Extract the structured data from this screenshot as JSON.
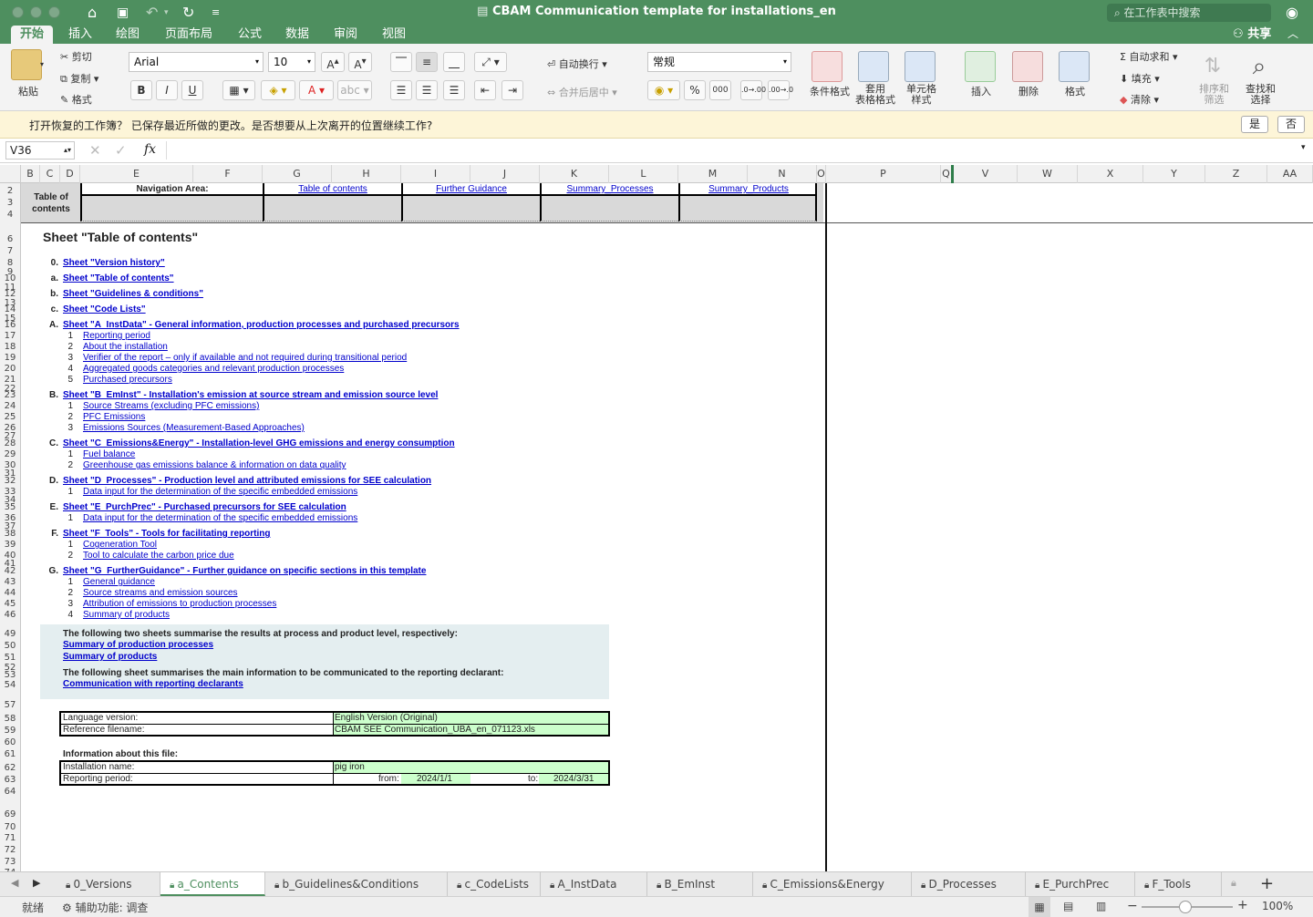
{
  "window": {
    "title": "CBAM Communication template for installations_en",
    "search_placeholder": "在工作表中搜索"
  },
  "ribbon_tabs": [
    "开始",
    "插入",
    "绘图",
    "页面布局",
    "公式",
    "数据",
    "审阅",
    "视图"
  ],
  "share_label": "共享",
  "ribbon": {
    "paste": "粘贴",
    "cut": "剪切",
    "copy": "复制",
    "format_painter": "格式",
    "font_name": "Arial",
    "font_size": "10",
    "bold": "B",
    "italic": "I",
    "underline": "U",
    "wrap_text": "自动换行",
    "merge_center": "合并后居中",
    "number_format": "常规",
    "percent": "%",
    "thousands": "000",
    "conditional_format": "条件格式",
    "table_format": "套用\n表格格式",
    "cell_style": "单元格\n样式",
    "insert": "插入",
    "delete": "删除",
    "format": "格式",
    "autosum": "自动求和",
    "fill": "填充",
    "clear": "清除",
    "sort_filter": "排序和\n筛选",
    "find_select": "查找和\n选择"
  },
  "recovery_bar": {
    "text": "打开恢复的工作簿？ 已保存最近所做的更改。是否想要从上次离开的位置继续工作?",
    "yes": "是",
    "no": "否"
  },
  "formula_bar": {
    "name_box": "V36",
    "fx": "fx",
    "formula": ""
  },
  "columns": [
    "B",
    "C",
    "D",
    "E",
    "F",
    "G",
    "H",
    "I",
    "J",
    "K",
    "L",
    "M",
    "N",
    "O",
    "P",
    "Q",
    "V",
    "W",
    "X",
    "Y",
    "Z",
    "AA"
  ],
  "rows": [
    "2",
    "3",
    "4",
    "6",
    "7",
    "8",
    "9",
    "10",
    "11",
    "12",
    "13",
    "14",
    "15",
    "16",
    "17",
    "18",
    "19",
    "20",
    "21",
    "22",
    "23",
    "24",
    "25",
    "26",
    "27",
    "28",
    "29",
    "30",
    "31",
    "32",
    "33",
    "34",
    "35",
    "36",
    "37",
    "38",
    "39",
    "40",
    "41",
    "42",
    "43",
    "44",
    "45",
    "46",
    "49",
    "50",
    "51",
    "52",
    "53",
    "54",
    "57",
    "58",
    "59",
    "60",
    "61",
    "62",
    "63",
    "64",
    "69",
    "70",
    "71",
    "72",
    "73",
    "74"
  ],
  "nav": {
    "toc_label": "Table of contents",
    "area_label": "Navigation Area:",
    "links": [
      "Table of contents",
      "Further Guidance",
      "Summary_Processes",
      "Summary_Products"
    ]
  },
  "heading": "Sheet \"Table of contents\"",
  "toc": [
    {
      "key": "0.",
      "title": "Sheet \"Version history\"",
      "items": []
    },
    {
      "key": "a.",
      "title": "Sheet \"Table of contents\"",
      "items": []
    },
    {
      "key": "b.",
      "title": "Sheet \"Guidelines & conditions\"",
      "items": []
    },
    {
      "key": "c.",
      "title": "Sheet \"Code Lists\"",
      "items": []
    },
    {
      "key": "A.",
      "title": "Sheet \"A_InstData\" - General information, production processes and purchased precursors ",
      "items": [
        {
          "n": "1",
          "t": "Reporting period"
        },
        {
          "n": "2",
          "t": "About the installation"
        },
        {
          "n": "3",
          "t": "Verifier of the report – only if available and not required during transitional period"
        },
        {
          "n": "4",
          "t": "Aggregated goods categories and relevant production processes"
        },
        {
          "n": "5",
          "t": "Purchased precursors"
        }
      ]
    },
    {
      "key": "B.",
      "title": "Sheet \"B_EmInst\" - Installation's emission at source stream and emission source level",
      "items": [
        {
          "n": "1",
          "t": "Source Streams (excluding PFC emissions)"
        },
        {
          "n": "2",
          "t": "PFC Emissions"
        },
        {
          "n": "3",
          "t": "Emissions Sources (Measurement-Based Approaches)"
        }
      ]
    },
    {
      "key": "C.",
      "title": "Sheet \"C_Emissions&Energy\" - Installation-level GHG emissions and energy consumption",
      "items": [
        {
          "n": "1",
          "t": "Fuel balance"
        },
        {
          "n": "2",
          "t": "Greenhouse gas emissions balance & information on data quality"
        }
      ]
    },
    {
      "key": "D.",
      "title": "Sheet \"D_Processes\" - Production level and attributed emissions for SEE calculation",
      "items": [
        {
          "n": "1",
          "t": "Data input for the determination of the specific embedded emissions"
        }
      ]
    },
    {
      "key": "E.",
      "title": "Sheet \"E_PurchPrec\" - Purchased precursors for SEE calculation",
      "items": [
        {
          "n": "1",
          "t": "Data input for the determination of the specific embedded emissions"
        }
      ]
    },
    {
      "key": "F.",
      "title": "Sheet \"F_Tools\" - Tools for facilitating reporting",
      "items": [
        {
          "n": "1",
          "t": "Cogeneration Tool"
        },
        {
          "n": "2",
          "t": "Tool to calculate the carbon price due"
        }
      ]
    },
    {
      "key": "G.",
      "title": "Sheet \"G_FurtherGuidance\" - Further guidance on specific sections in this template",
      "items": [
        {
          "n": "1",
          "t": "General guidance"
        },
        {
          "n": "2",
          "t": "Source streams and emission sources"
        },
        {
          "n": "3",
          "t": "Attribution of emissions to production processes"
        },
        {
          "n": "4",
          "t": "Summary of products"
        }
      ]
    }
  ],
  "summary_box": {
    "text1": "The following two sheets summarise the results at process and product level, respectively:",
    "link1": "Summary of production processes",
    "link2": "Summary of products",
    "text2": "The following sheet summarises the main information to be communicated to the reporting declarant:",
    "link3": "Communication with reporting declarants"
  },
  "file_info": {
    "language_label": "Language version:",
    "language_value": "English Version (Original)",
    "filename_label": "Reference filename:",
    "filename_value": "CBAM SEE Communication_UBA_en_071123.xls",
    "about_label": "Information about this file:",
    "installation_label": "Installation name:",
    "installation_value": "pig iron",
    "period_label": "Reporting period:",
    "from_label": "from:",
    "from_value": "2024/1/1",
    "to_label": "to:",
    "to_value": "2024/3/31"
  },
  "sheet_tabs": [
    "0_Versions",
    "a_Contents",
    "b_Guidelines&Conditions",
    "c_CodeLists",
    "A_InstData",
    "B_EmInst",
    "C_Emissions&Energy",
    "D_Processes",
    "E_PurchPrec",
    "F_Tools"
  ],
  "active_sheet": "a_Contents",
  "status": {
    "ready": "就绪",
    "accessibility": "辅助功能: 调查",
    "zoom": "100%"
  },
  "colors": {
    "titlebar": "#4e8f5f",
    "link": "#0000cc",
    "input_green": "#ccffcc",
    "summary_bg": "#e4eef0"
  }
}
